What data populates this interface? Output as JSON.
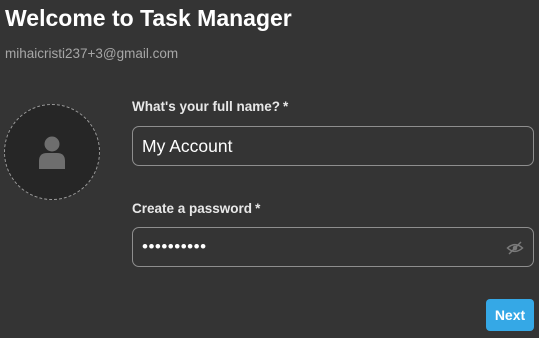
{
  "header": {
    "title": "Welcome to Task Manager",
    "email": "mihaicristi237+3@gmail.com"
  },
  "avatar": {
    "icon": "user-icon"
  },
  "form": {
    "full_name": {
      "label": "What's your full name?",
      "required_mark": "*",
      "value": "My Account"
    },
    "password": {
      "label": "Create a password",
      "required_mark": "*",
      "value": "••••••••••",
      "visibility_icon": "eye-off-icon"
    }
  },
  "actions": {
    "next_label": "Next"
  },
  "colors": {
    "background": "#343434",
    "accent": "#35a8e6",
    "field_border": "#8e8e8e",
    "muted_text": "#a6a6a6"
  }
}
